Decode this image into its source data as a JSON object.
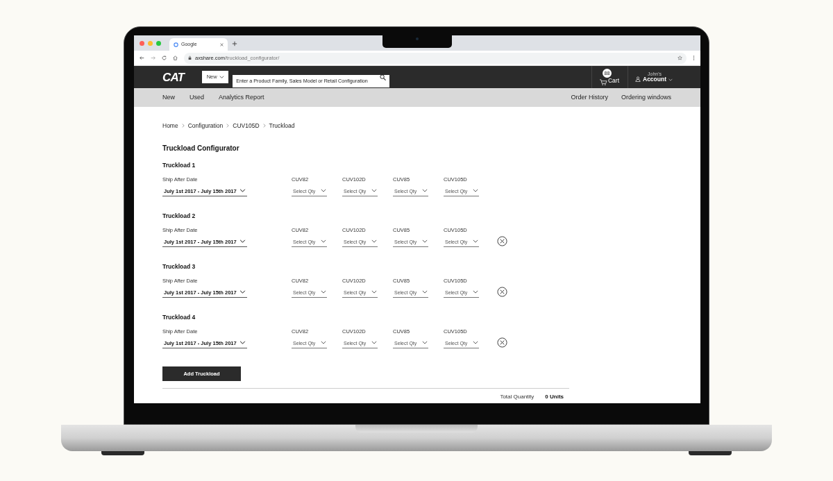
{
  "browser": {
    "tab_title": "Google",
    "url_domain": "axshare.com",
    "url_path": "/truckload_configurator/"
  },
  "header": {
    "logo": "CAT",
    "mode_select": "New",
    "search_placeholder": "Enter a Product Family, Sales Model or Retail Configuration",
    "cart": {
      "count": "88",
      "label": "Cart"
    },
    "account": {
      "greeting": "John's",
      "label": "Account"
    }
  },
  "nav": {
    "left": [
      "New",
      "Used",
      "Analytics Report"
    ],
    "right": [
      "Order History",
      "Ordering windows"
    ]
  },
  "breadcrumb": [
    "Home",
    "Configuration",
    "CUV105D",
    "Truckload"
  ],
  "title": "Truckload Configurator",
  "truckloads": [
    {
      "title": "Truckload 1",
      "date_label": "Ship After Date",
      "date_value": "July 1st 2017 - July 15th 2017",
      "removable": false,
      "models": [
        {
          "name": "CUV82",
          "value": "Select Qty"
        },
        {
          "name": "CUV102D",
          "value": "Select Qty"
        },
        {
          "name": "CUV85",
          "value": "Select Qty"
        },
        {
          "name": "CUV105D",
          "value": "Select Qty"
        }
      ]
    },
    {
      "title": "Truckload 2",
      "date_label": "Ship After Date",
      "date_value": "July 1st 2017 - July 15th 2017",
      "removable": true,
      "models": [
        {
          "name": "CUV82",
          "value": "Select Qty"
        },
        {
          "name": "CUV102D",
          "value": "Select Qty"
        },
        {
          "name": "CUV85",
          "value": "Select Qty"
        },
        {
          "name": "CUV105D",
          "value": "Select Qty"
        }
      ]
    },
    {
      "title": "Truckload 3",
      "date_label": "Ship After Date",
      "date_value": "July 1st 2017 - July 15th 2017",
      "removable": true,
      "models": [
        {
          "name": "CUV82",
          "value": "Select Qty"
        },
        {
          "name": "CUV102D",
          "value": "Select Qty"
        },
        {
          "name": "CUV85",
          "value": "Select Qty"
        },
        {
          "name": "CUV105D",
          "value": "Select Qty"
        }
      ]
    },
    {
      "title": "Truckload 4",
      "date_label": "Ship After Date",
      "date_value": "July 1st 2017 - July 15th 2017",
      "removable": true,
      "models": [
        {
          "name": "CUV82",
          "value": "Select Qty"
        },
        {
          "name": "CUV102D",
          "value": "Select Qty"
        },
        {
          "name": "CUV85",
          "value": "Select Qty"
        },
        {
          "name": "CUV105D",
          "value": "Select Qty"
        }
      ]
    }
  ],
  "add_button": "Add Truckload",
  "total_label": "Total Quantity",
  "total_value": "0 Units"
}
